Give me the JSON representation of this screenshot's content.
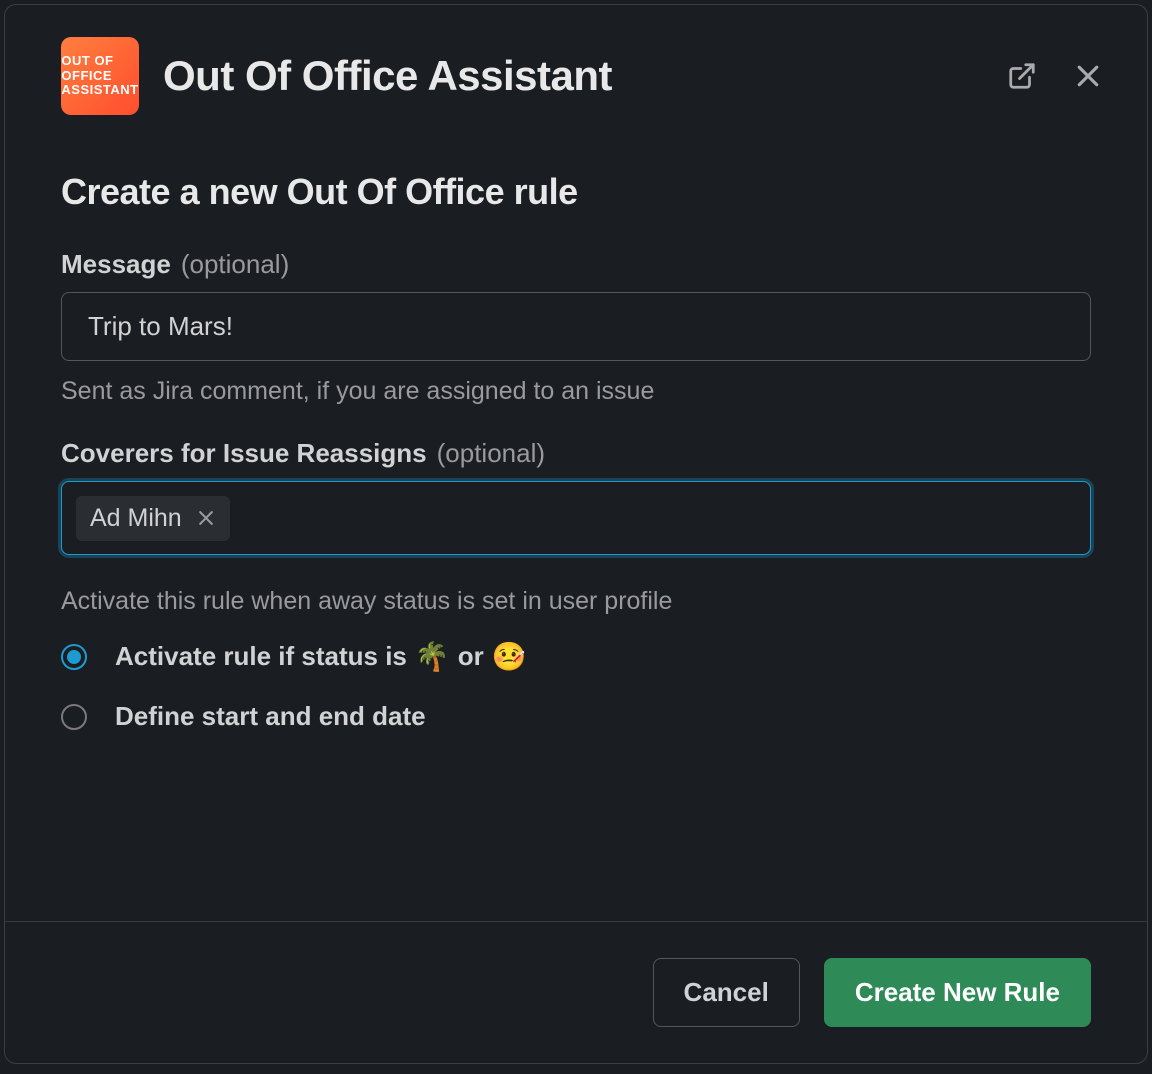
{
  "header": {
    "app_icon_text": "OUT OF\nOFFICE\nASSISTANT",
    "title": "Out Of Office Assistant"
  },
  "body": {
    "section_title": "Create a new Out Of Office rule",
    "message_field": {
      "label": "Message",
      "optional": "(optional)",
      "value": "Trip to Mars!",
      "help": "Sent as Jira comment, if you are assigned to an issue"
    },
    "coverers_field": {
      "label": "Coverers for Issue Reassigns",
      "optional": "(optional)",
      "chips": [
        {
          "name": "Ad Mihn"
        }
      ]
    },
    "activation_hint": "Activate this rule when away status is set in user profile",
    "radio_options": [
      {
        "label_pre": "Activate rule if status is",
        "emoji1": "🌴",
        "connector": "or",
        "emoji2": "🤒",
        "selected": true
      },
      {
        "label": "Define start and end date",
        "selected": false
      }
    ]
  },
  "footer": {
    "cancel": "Cancel",
    "create": "Create New Rule"
  }
}
